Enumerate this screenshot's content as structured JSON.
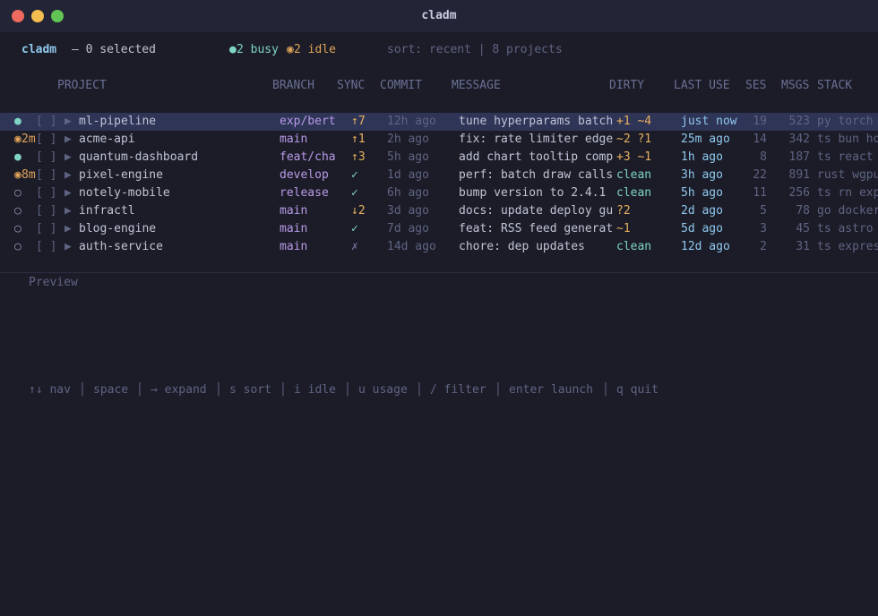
{
  "window": {
    "title": "cladm"
  },
  "header": {
    "app_name": "cladm",
    "selected": "— 0 selected",
    "busy_glyph": "●",
    "busy": "2 busy",
    "idle_glyph": "◉",
    "idle": "2 idle",
    "sort": "sort: recent | 8 projects"
  },
  "columns": {
    "project": "PROJECT",
    "branch": "BRANCH",
    "sync": "SYNC",
    "commit": "COMMIT",
    "message": "MESSAGE",
    "dirty": "DIRTY",
    "last_use": "LAST USE",
    "ses": "SES",
    "msgs": "MSGS",
    "stack": "STACK"
  },
  "rows": [
    {
      "status": "●",
      "idle_time": "",
      "check": "[ ]",
      "arrow": "▶",
      "project": "ml-pipeline",
      "branch": "exp/bert",
      "sync": "↑7",
      "commit": "12h ago",
      "message": "tune hyperparams batch",
      "dirty": "+1 ~4",
      "last_use": "just now",
      "ses": "19",
      "msgs": "523",
      "stack": "py torch"
    },
    {
      "status": "◉",
      "idle_time": "2m",
      "check": "[ ]",
      "arrow": "▶",
      "project": "acme-api",
      "branch": "main",
      "sync": "↑1",
      "commit": "2h ago",
      "message": "fix: rate limiter edge",
      "dirty": "~2 ?1",
      "last_use": "25m ago",
      "ses": "14",
      "msgs": "342",
      "stack": "ts bun ho"
    },
    {
      "status": "●",
      "idle_time": "",
      "check": "[ ]",
      "arrow": "▶",
      "project": "quantum-dashboard",
      "branch": "feat/cha",
      "sync": "↑3",
      "commit": "5h ago",
      "message": "add chart tooltip comp",
      "dirty": "+3 ~1",
      "last_use": "1h ago",
      "ses": "8",
      "msgs": "187",
      "stack": "ts react"
    },
    {
      "status": "◉",
      "idle_time": "8m",
      "check": "[ ]",
      "arrow": "▶",
      "project": "pixel-engine",
      "branch": "develop",
      "sync": "✓",
      "commit": "1d ago",
      "message": "perf: batch draw calls",
      "dirty": "clean",
      "last_use": "3h ago",
      "ses": "22",
      "msgs": "891",
      "stack": "rust wgpu"
    },
    {
      "status": "○",
      "idle_time": "",
      "check": "[ ]",
      "arrow": "▶",
      "project": "notely-mobile",
      "branch": "release",
      "sync": "✓",
      "commit": "6h ago",
      "message": "bump version to 2.4.1",
      "dirty": "clean",
      "last_use": "5h ago",
      "ses": "11",
      "msgs": "256",
      "stack": "ts rn exp"
    },
    {
      "status": "○",
      "idle_time": "",
      "check": "[ ]",
      "arrow": "▶",
      "project": "infractl",
      "branch": "main",
      "sync": "↓2",
      "commit": "3d ago",
      "message": "docs: update deploy gu",
      "dirty": "?2",
      "last_use": "2d ago",
      "ses": "5",
      "msgs": "78",
      "stack": "go docker"
    },
    {
      "status": "○",
      "idle_time": "",
      "check": "[ ]",
      "arrow": "▶",
      "project": "blog-engine",
      "branch": "main",
      "sync": "✓",
      "commit": "7d ago",
      "message": "feat: RSS feed generat",
      "dirty": "~1",
      "last_use": "5d ago",
      "ses": "3",
      "msgs": "45",
      "stack": "ts astro"
    },
    {
      "status": "○",
      "idle_time": "",
      "check": "[ ]",
      "arrow": "▶",
      "project": "auth-service",
      "branch": "main",
      "sync": "✗",
      "commit": "14d ago",
      "message": "chore: dep updates",
      "dirty": "clean",
      "last_use": "12d ago",
      "ses": "2",
      "msgs": "31",
      "stack": "ts expres"
    }
  ],
  "preview": {
    "label": "Preview"
  },
  "footer": {
    "nav": "↑↓ nav",
    "space": "space",
    "expand": "→ expand",
    "sort": "s sort",
    "idle": "i idle",
    "usage": "u usage",
    "filter": "/ filter",
    "launch": "enter launch",
    "quit": "q quit",
    "sep": "│"
  },
  "colors": {
    "background": "#1b1c27",
    "selected_row": "#2e3556",
    "busy": "#7fd4c4",
    "idle": "#e0a45a",
    "branch": "#b89ae8",
    "last_use": "#8fc8ee",
    "clean": "#7fd4c4",
    "dirty_warn": "#e8b060"
  }
}
